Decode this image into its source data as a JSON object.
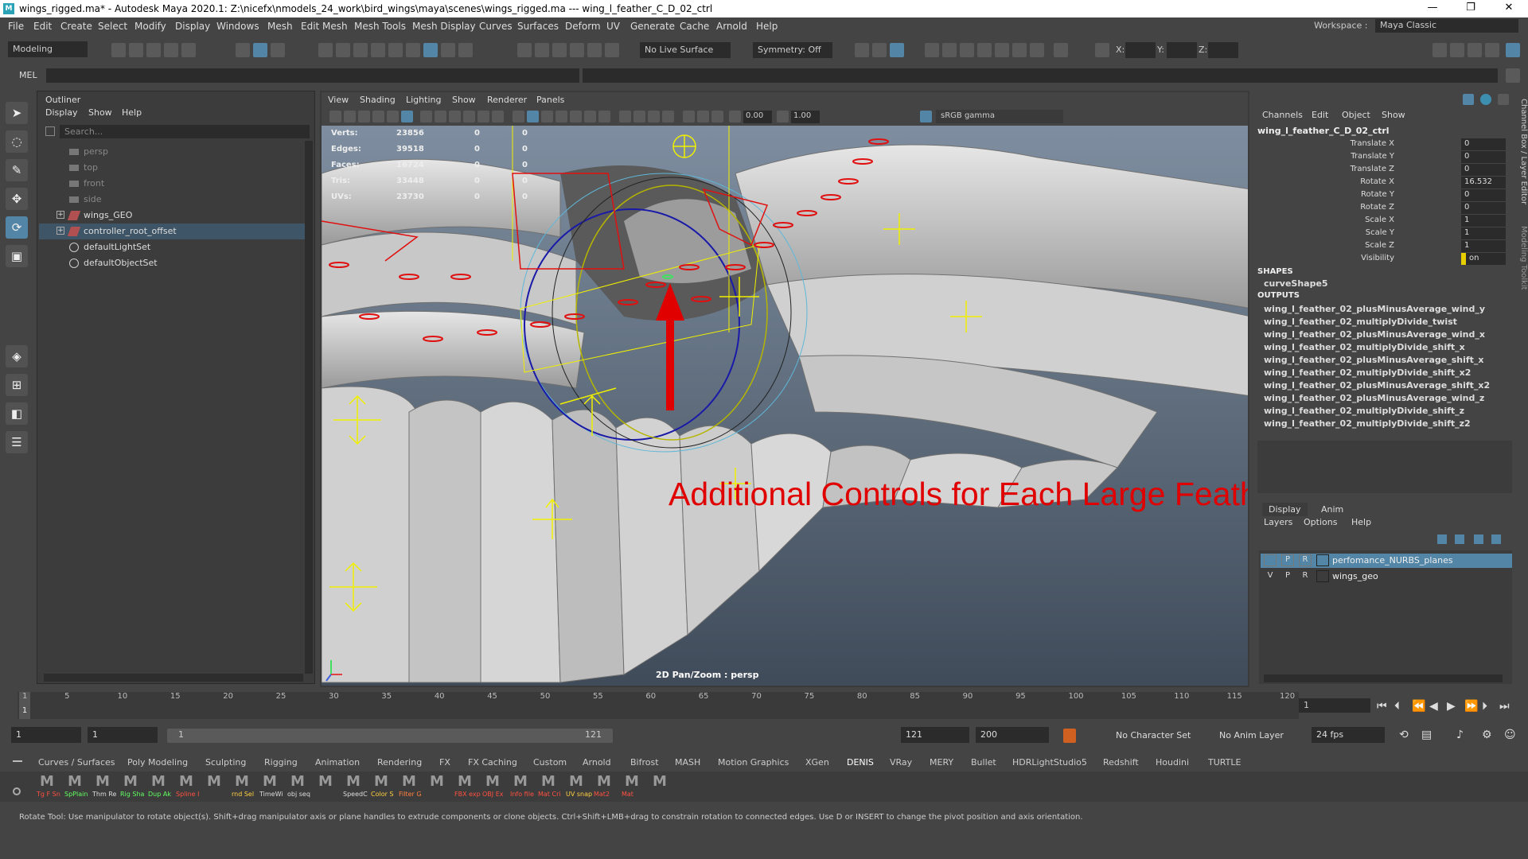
{
  "titlebar": {
    "title": "wings_rigged.ma* - Autodesk Maya 2020.1: Z:\\nicefx\\nmodels_24_work\\bird_wings\\maya\\scenes\\wings_rigged.ma  ---  wing_l_feather_C_D_02_ctrl",
    "minimize": "—",
    "maximize": "❐",
    "close": "✕"
  },
  "menubar": {
    "items": [
      "File",
      "Edit",
      "Create",
      "Select",
      "Modify",
      "Display",
      "Windows",
      "Mesh",
      "Edit Mesh",
      "Mesh Tools",
      "Mesh Display",
      "Curves",
      "Surfaces",
      "Deform",
      "UV",
      "Generate",
      "Cache",
      "Arnold",
      "Help"
    ],
    "workspace_label": "Workspace :",
    "workspace_value": "Maya Classic"
  },
  "statusline": {
    "mode": "Modeling",
    "live_surface": "No Live Surface",
    "symmetry": "Symmetry: Off",
    "x_label": "X:",
    "y_label": "Y:",
    "z_label": "Z:"
  },
  "mel": {
    "label": "MEL"
  },
  "outliner": {
    "title": "Outliner",
    "menu": [
      "Display",
      "Show",
      "Help"
    ],
    "search_placeholder": "Search...",
    "items": [
      {
        "label": "persp"
      },
      {
        "label": "top"
      },
      {
        "label": "front"
      },
      {
        "label": "side"
      },
      {
        "label": "wings_GEO"
      },
      {
        "label": "controller_root_offset"
      },
      {
        "label": "defaultLightSet"
      },
      {
        "label": "defaultObjectSet"
      }
    ]
  },
  "viewport": {
    "menu": [
      "View",
      "Shading",
      "Lighting",
      "Show",
      "Renderer",
      "Panels"
    ],
    "exposure": "0.00",
    "gamma_value": "1.00",
    "color_space": "sRGB gamma",
    "stats": [
      {
        "label": "Verts:",
        "v1": "23856",
        "v2": "0",
        "v3": "0"
      },
      {
        "label": "Edges:",
        "v1": "39518",
        "v2": "0",
        "v3": "0"
      },
      {
        "label": "Faces:",
        "v1": "16724",
        "v2": "0",
        "v3": "0"
      },
      {
        "label": "Tris:",
        "v1": "33448",
        "v2": "0",
        "v3": "0"
      },
      {
        "label": "UVs:",
        "v1": "23730",
        "v2": "0",
        "v3": "0"
      }
    ],
    "camera_label": "2D Pan/Zoom : persp",
    "annotation": "Additional Controls for Each Large Feather",
    "colors": {
      "annotation": "#e00000",
      "controls": "#f0f000",
      "selected": "#e01010"
    }
  },
  "channelbox": {
    "menu": [
      "Channels",
      "Edit",
      "Object",
      "Show"
    ],
    "object": "wing_l_feather_C_D_02_ctrl",
    "attributes": [
      {
        "name": "Translate X",
        "value": "0"
      },
      {
        "name": "Translate Y",
        "value": "0"
      },
      {
        "name": "Translate Z",
        "value": "0"
      },
      {
        "name": "Rotate X",
        "value": "16.532"
      },
      {
        "name": "Rotate Y",
        "value": "0"
      },
      {
        "name": "Rotate Z",
        "value": "0"
      },
      {
        "name": "Scale X",
        "value": "1"
      },
      {
        "name": "Scale Y",
        "value": "1"
      },
      {
        "name": "Scale Z",
        "value": "1"
      },
      {
        "name": "Visibility",
        "value": "on"
      }
    ],
    "shapes_label": "SHAPES",
    "shape": "curveShape5",
    "outputs_label": "OUTPUTS",
    "outputs": [
      "wing_l_feather_02_plusMinusAverage_wind_y",
      "wing_l_feather_02_multiplyDivide_twist",
      "wing_l_feather_02_plusMinusAverage_wind_x",
      "wing_l_feather_02_multiplyDivide_shift_x",
      "wing_l_feather_02_plusMinusAverage_shift_x",
      "wing_l_feather_02_multiplyDivide_shift_x2",
      "wing_l_feather_02_plusMinusAverage_shift_x2",
      "wing_l_feather_02_plusMinusAverage_wind_z",
      "wing_l_feather_02_multiplyDivide_shift_z",
      "wing_l_feather_02_multiplyDivide_shift_z2"
    ],
    "side_tabs": [
      "Channel Box / Layer Editor",
      "Modeling Toolkit"
    ]
  },
  "layers": {
    "tabs": [
      "Display",
      "Anim"
    ],
    "menu": [
      "Layers",
      "Options",
      "Help"
    ],
    "rows": [
      {
        "v": "",
        "p": "P",
        "r": "R",
        "name": "perfomance_NURBS_planes"
      },
      {
        "v": "V",
        "p": "P",
        "r": "R",
        "name": "wings_geo"
      }
    ]
  },
  "timeline": {
    "ticks": [
      "1",
      "5",
      "10",
      "15",
      "20",
      "25",
      "30",
      "35",
      "40",
      "45",
      "50",
      "55",
      "60",
      "65",
      "70",
      "75",
      "80",
      "85",
      "90",
      "95",
      "100",
      "105",
      "110",
      "115",
      "120"
    ],
    "current_frame": "1"
  },
  "range": {
    "start": "1",
    "anim_start": "1",
    "slider_start": "1",
    "slider_end": "121",
    "end": "121",
    "anim_end": "200",
    "character_set": "No Character Set",
    "anim_layer": "No Anim Layer",
    "fps": "24 fps"
  },
  "shelf": {
    "tabs": [
      "Curves / Surfaces",
      "Poly Modeling",
      "Sculpting",
      "Rigging",
      "Animation",
      "Rendering",
      "FX",
      "FX Caching",
      "Custom",
      "Arnold",
      "Bifrost",
      "MASH",
      "Motion Graphics",
      "XGen",
      "DENIS",
      "VRay",
      "MERY",
      "Bullet",
      "HDRLightStudio5",
      "Redshift",
      "Houdini",
      "TURTLE"
    ],
    "active_tab": "DENIS",
    "icons": [
      {
        "caption": "Tg F Sn",
        "color": "#ff5040"
      },
      {
        "caption": "SpPlain",
        "color": "#60ff60"
      },
      {
        "caption": "Thm Re",
        "color": "#dddddd"
      },
      {
        "caption": "Rig Sha",
        "color": "#60ff60"
      },
      {
        "caption": "Dup Ak",
        "color": "#60ff60"
      },
      {
        "caption": "Spline I",
        "color": "#ff5040"
      },
      {
        "caption": "",
        "color": "#dddddd"
      },
      {
        "caption": "rnd Sel",
        "color": "#ffd040"
      },
      {
        "caption": "TimeWi",
        "color": "#dddddd"
      },
      {
        "caption": "obj seq",
        "color": "#dddddd"
      },
      {
        "caption": "",
        "color": "#dddddd"
      },
      {
        "caption": "SpeedC",
        "color": "#dddddd"
      },
      {
        "caption": "Color S",
        "color": "#ffd040"
      },
      {
        "caption": "Filter G",
        "color": "#ff8040"
      },
      {
        "caption": "",
        "color": "#dddddd"
      },
      {
        "caption": "FBX exp",
        "color": "#ff5040"
      },
      {
        "caption": "OBJ Ex",
        "color": "#ff5040"
      },
      {
        "caption": "Info file",
        "color": "#ff5040"
      },
      {
        "caption": "Mat Cri",
        "color": "#ff5040"
      },
      {
        "caption": "UV snap",
        "color": "#ffd040"
      },
      {
        "caption": "Mat2",
        "color": "#ff5040"
      },
      {
        "caption": "Mat",
        "color": "#ff5040"
      },
      {
        "caption": "",
        "color": "#dddddd"
      }
    ]
  },
  "help": {
    "text": "Rotate Tool: Use manipulator to rotate object(s). Shift+drag manipulator axis or plane handles to extrude components or clone objects. Ctrl+Shift+LMB+drag to constrain rotation to connected edges. Use D or INSERT to change the pivot position and axis orientation."
  }
}
